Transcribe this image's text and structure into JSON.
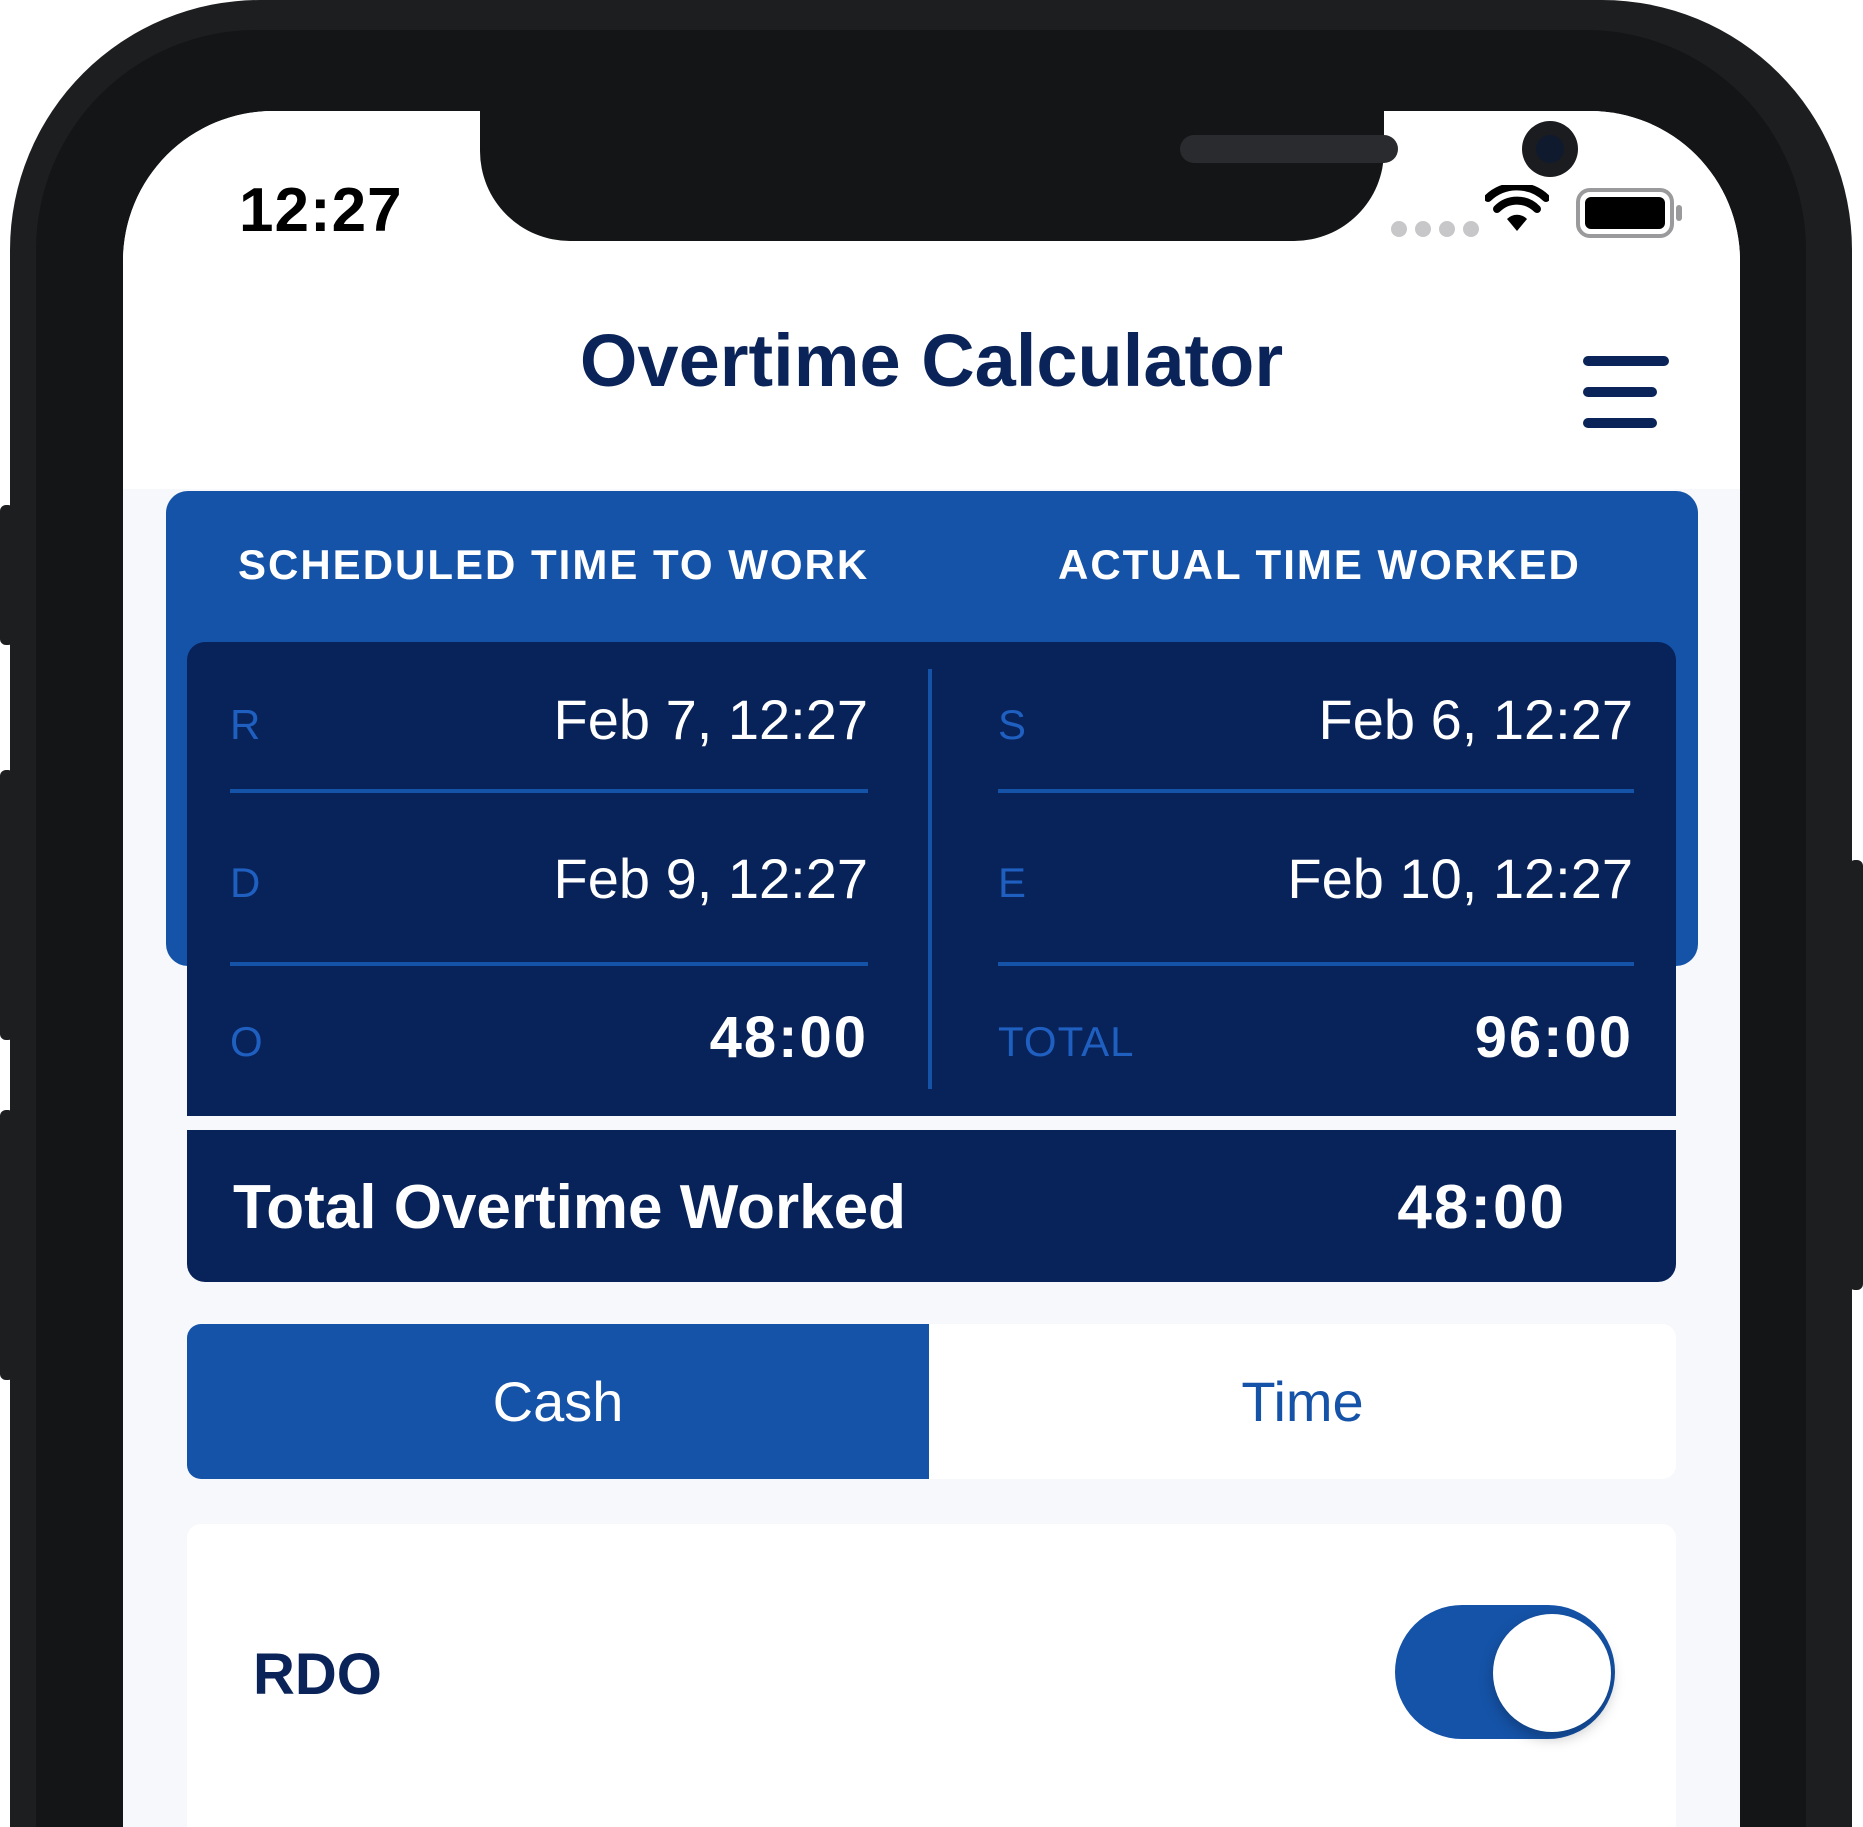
{
  "status_bar": {
    "time": "12:27"
  },
  "header": {
    "title": "Overtime Calculator",
    "menu_icon": "hamburger-menu-icon"
  },
  "scheduled": {
    "heading": "SCHEDULED TIME TO WORK",
    "rows": [
      {
        "label": "R",
        "value": "Feb 7, 12:27"
      },
      {
        "label": "D",
        "value": "Feb 9, 12:27"
      },
      {
        "label": "O",
        "value": "48:00"
      }
    ]
  },
  "actual": {
    "heading": "ACTUAL TIME WORKED",
    "rows": [
      {
        "label": "S",
        "value": "Feb 6, 12:27"
      },
      {
        "label": "E",
        "value": "Feb 10, 12:27"
      },
      {
        "label": "TOTAL",
        "value": "96:00"
      }
    ]
  },
  "total_overtime": {
    "label": "Total Overtime Worked",
    "value": "48:00"
  },
  "compensation": {
    "options": [
      "Cash",
      "Time"
    ],
    "selected": "Cash"
  },
  "rdo": {
    "label": "RDO",
    "enabled": true
  },
  "colors": {
    "primary_blue": "#1553a8",
    "navy": "#08225a",
    "title_navy": "#0a2358"
  }
}
